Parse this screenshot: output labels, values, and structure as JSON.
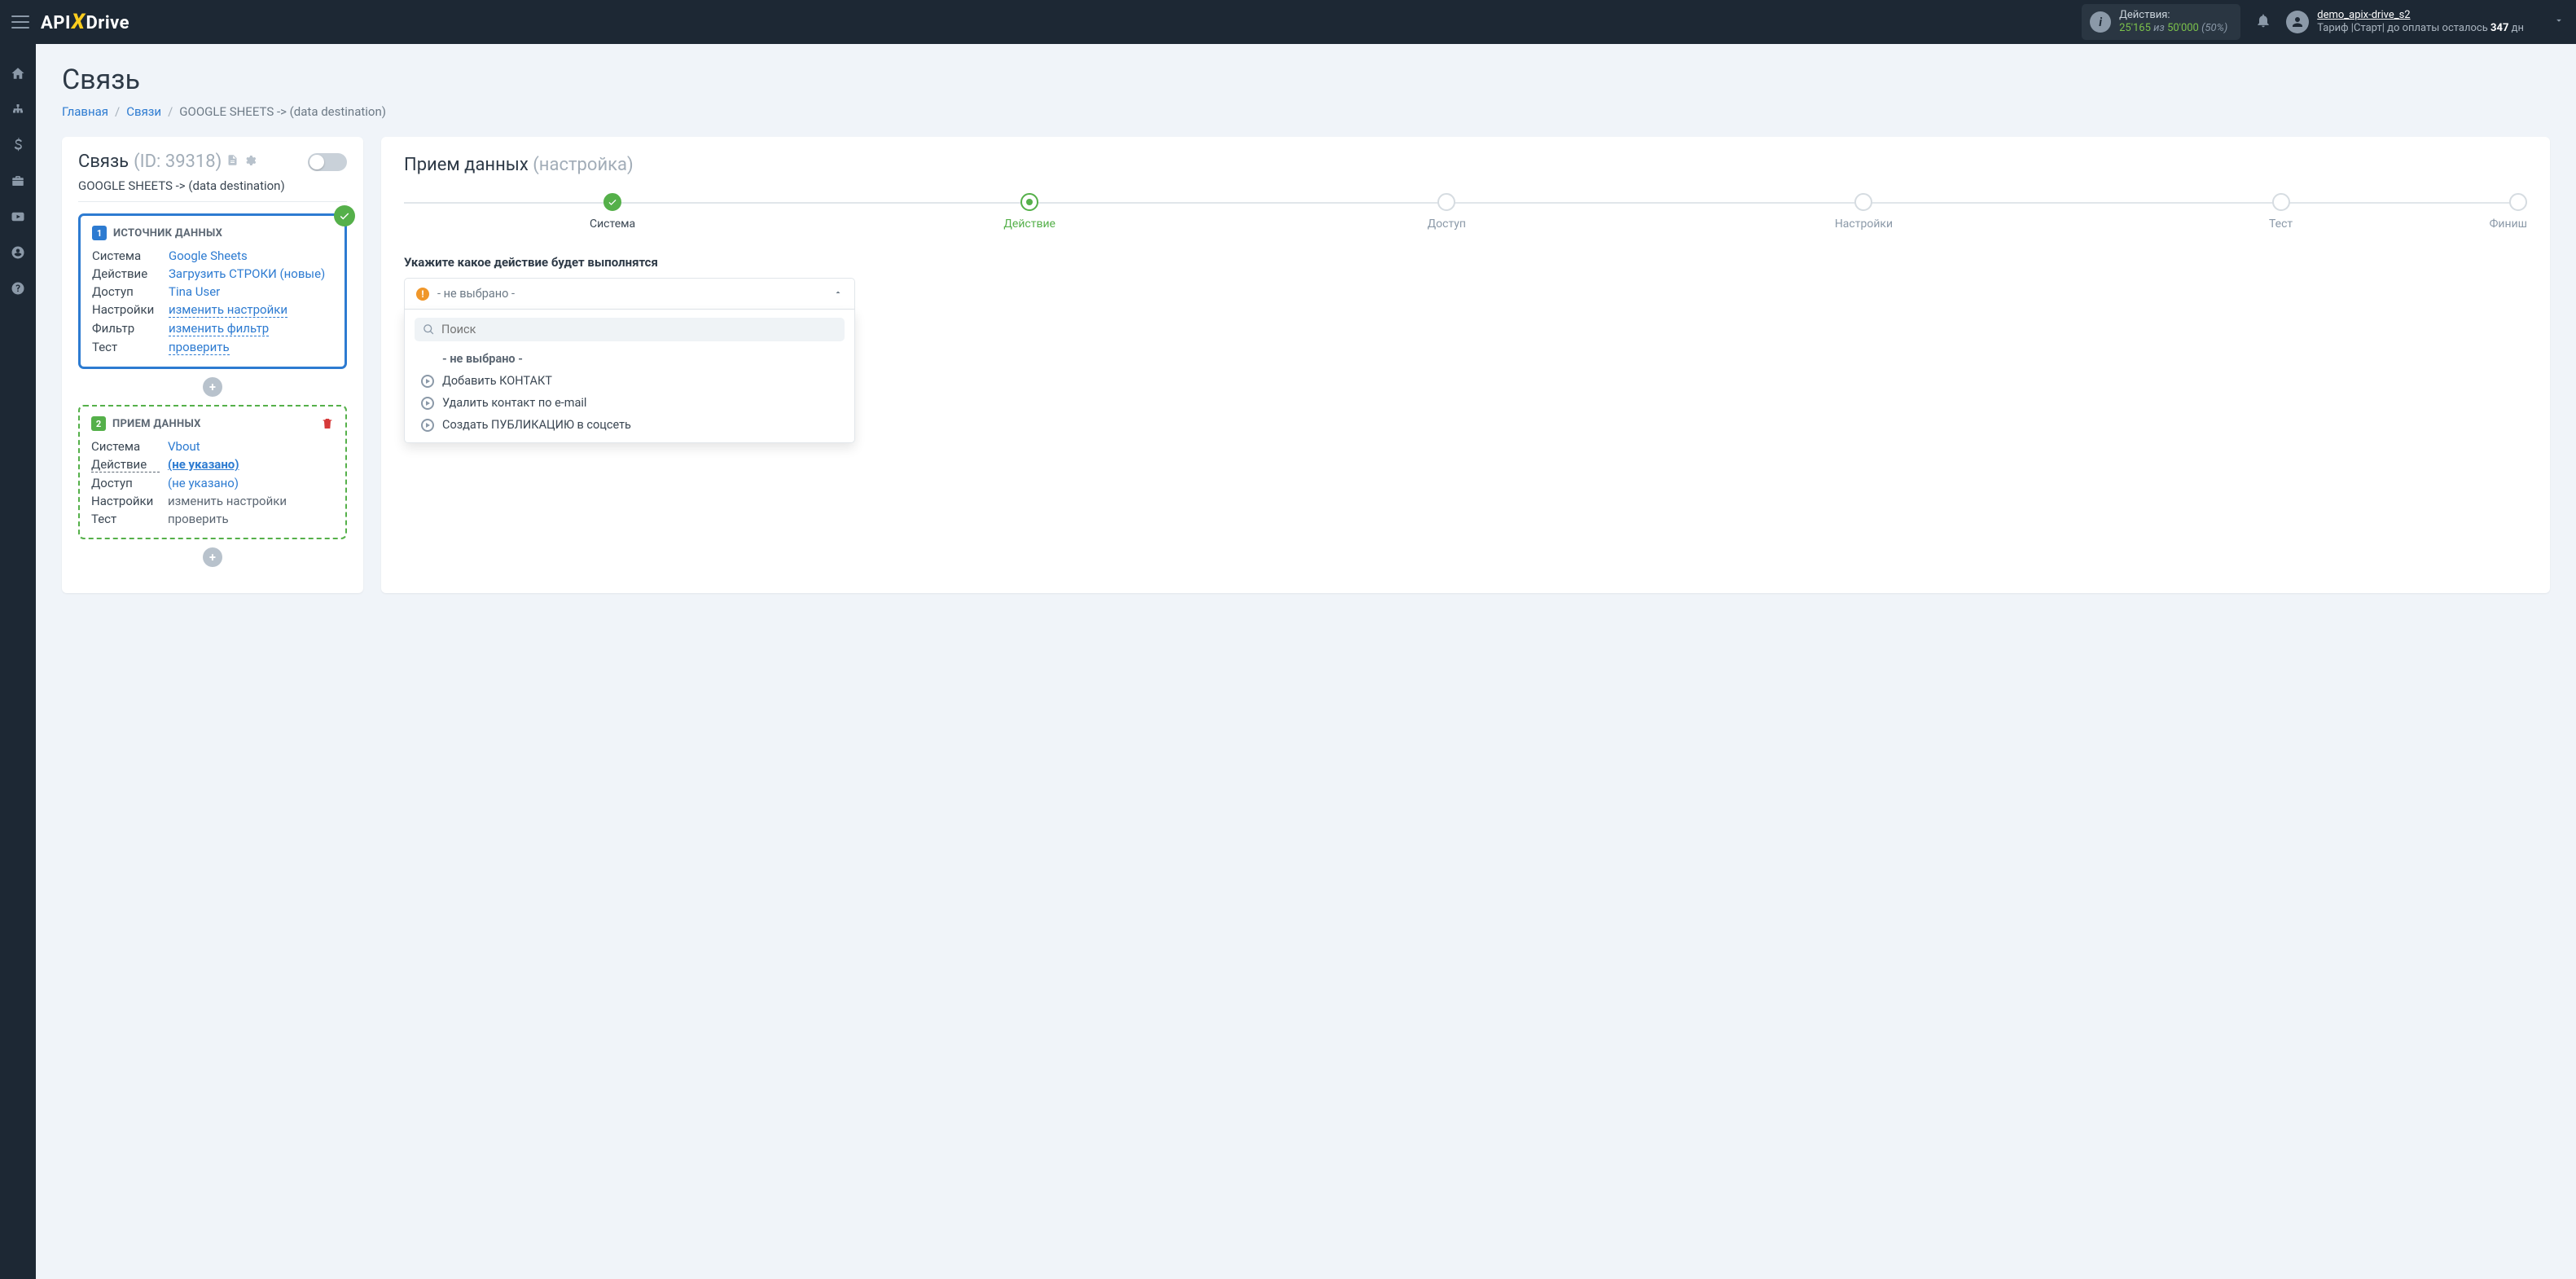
{
  "header": {
    "actions_label": "Действия:",
    "actions_used": "25'165",
    "actions_of": "из",
    "actions_total": "50'000",
    "actions_pct": "(50%)",
    "user_name": "demo_apix-drive_s2",
    "tariff_prefix": "Тариф |Старт| до оплаты осталось ",
    "tariff_days": "347",
    "tariff_suffix": " дн"
  },
  "page": {
    "title": "Связь",
    "crumb_home": "Главная",
    "crumb_links": "Связи",
    "crumb_current": "GOOGLE SHEETS -> (data destination)"
  },
  "left": {
    "title": "Связь",
    "id_label": "(ID: 39318)",
    "conn_name": "GOOGLE SHEETS -> (data destination)",
    "src": {
      "heading": "ИСТОЧНИК ДАННЫХ",
      "rows": {
        "system_l": "Система",
        "system_v": "Google Sheets",
        "action_l": "Действие",
        "action_v": "Загрузить СТРОКИ (новые)",
        "access_l": "Доступ",
        "access_v": "Tina User",
        "settings_l": "Настройки",
        "settings_v": "изменить настройки",
        "filter_l": "Фильтр",
        "filter_v": "изменить фильтр",
        "test_l": "Тест",
        "test_v": "проверить"
      }
    },
    "dst": {
      "heading": "ПРИЕМ ДАННЫХ",
      "rows": {
        "system_l": "Система",
        "system_v": "Vbout",
        "action_l": "Действие",
        "action_v": "(не указано)",
        "access_l": "Доступ",
        "access_v": "(не указано)",
        "settings_l": "Настройки",
        "settings_v": "изменить настройки",
        "test_l": "Тест",
        "test_v": "проверить"
      }
    }
  },
  "right": {
    "title": "Прием данных",
    "subtitle": "(настройка)",
    "steps": [
      "Система",
      "Действие",
      "Доступ",
      "Настройки",
      "Тест",
      "Финиш"
    ],
    "field_label": "Укажите какое действие будет выполнятся",
    "select_placeholder": "- не выбрано -",
    "search_placeholder": "Поиск",
    "options": {
      "none": "- не выбрано -",
      "o1": "Добавить КОНТАКТ",
      "o2": "Удалить контакт по e-mail",
      "o3": "Создать ПУБЛИКАЦИЮ в соцсеть"
    }
  }
}
